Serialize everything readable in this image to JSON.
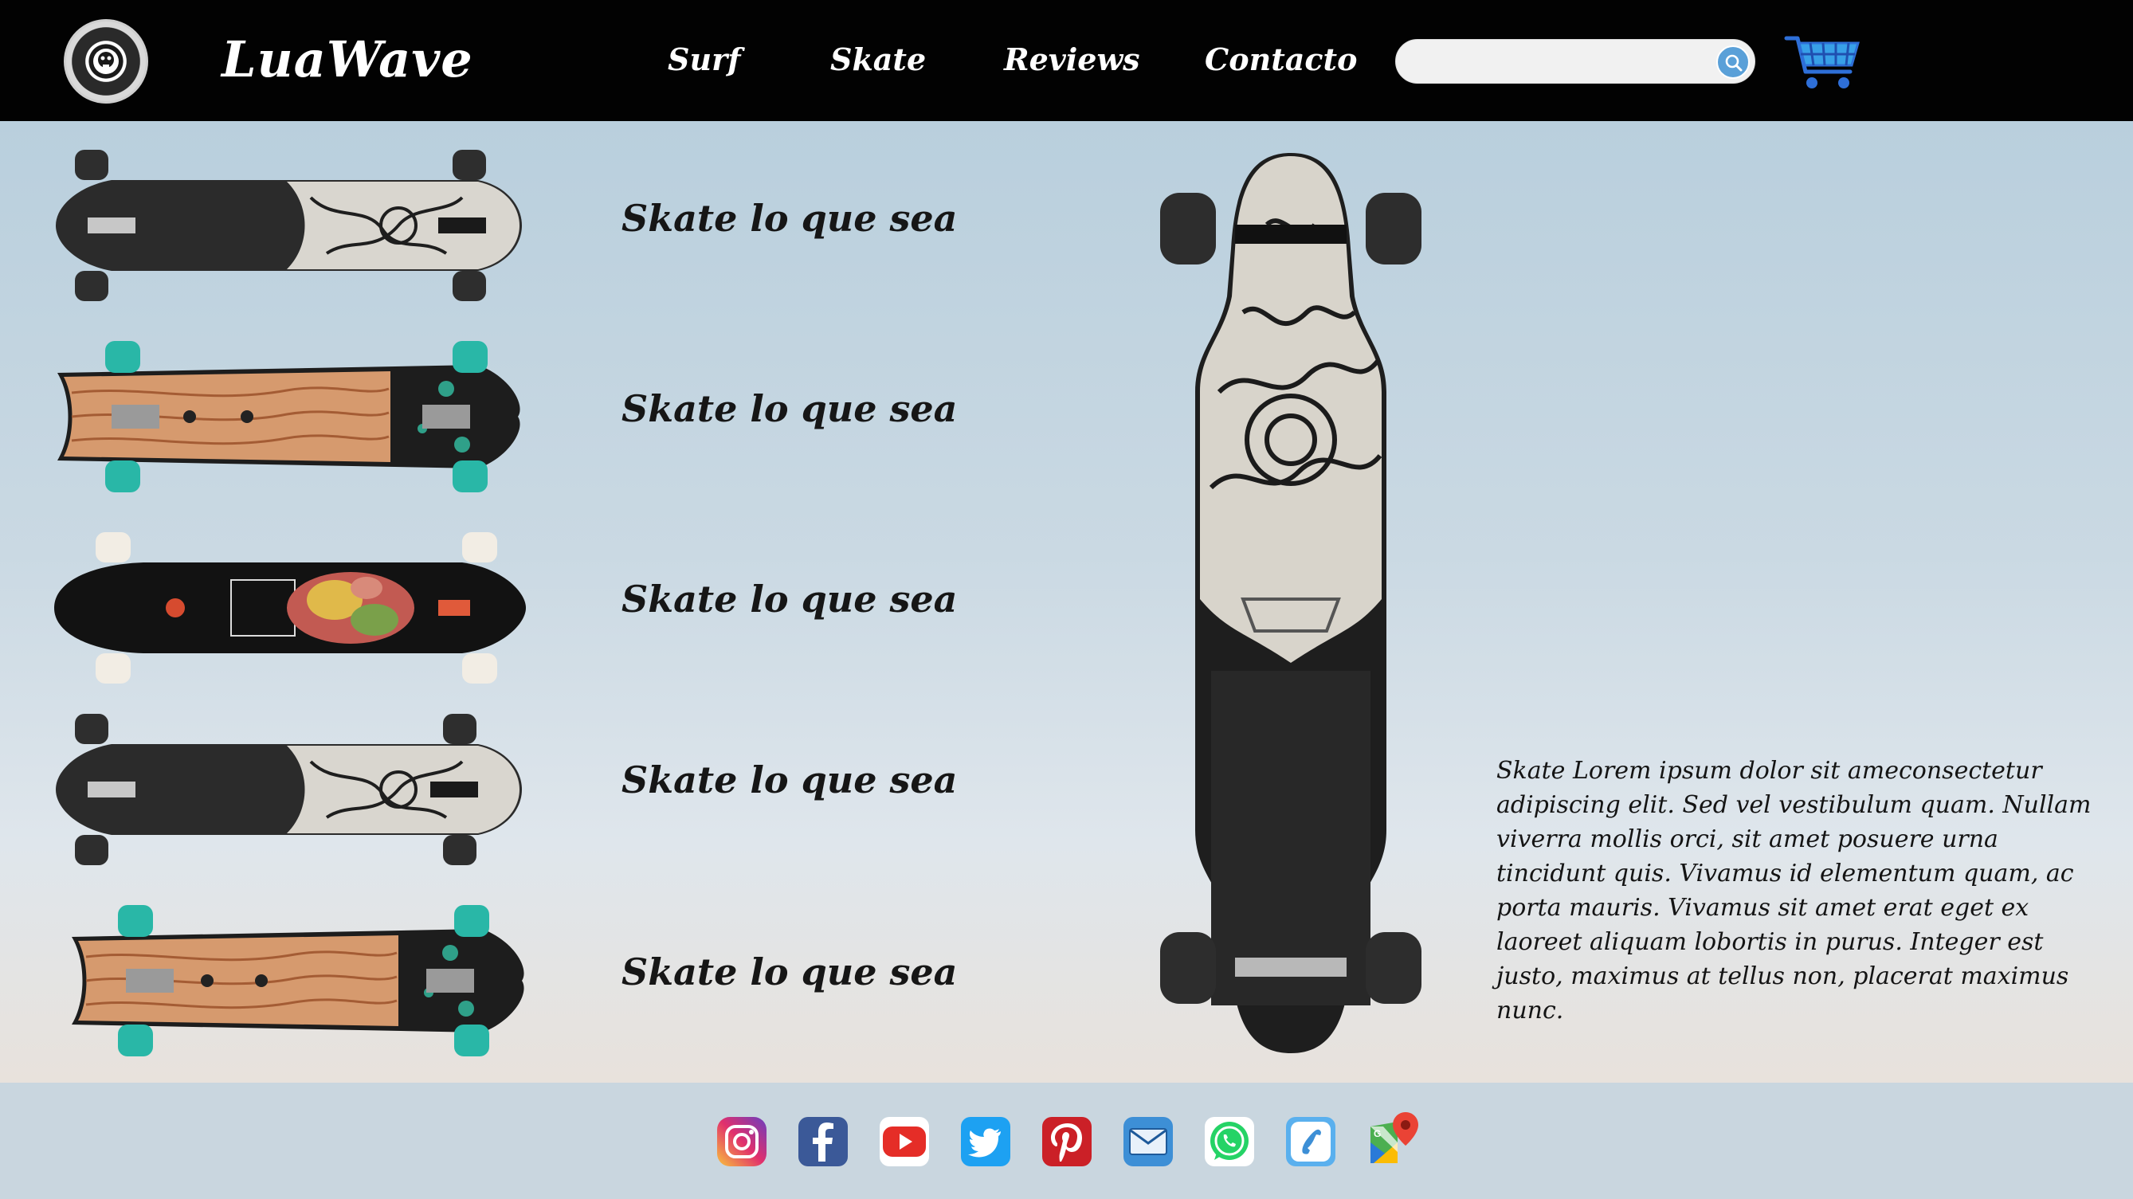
{
  "header": {
    "brand": "LuaWave",
    "logo_icon": "skull-wheel-logo-icon",
    "nav": [
      {
        "label": "Surf"
      },
      {
        "label": "Skate"
      },
      {
        "label": "Reviews"
      },
      {
        "label": "Contacto"
      }
    ],
    "search": {
      "value": "",
      "placeholder": "",
      "icon": "search-icon"
    },
    "cart_icon": "shopping-cart-icon"
  },
  "products": [
    {
      "label": "Skate lo que sea",
      "board": "black-floral-drop-through"
    },
    {
      "label": "Skate lo que sea",
      "board": "wood-grain-fishtail-teal-wheels"
    },
    {
      "label": "Skate lo que sea",
      "board": "black-botanical-pintail"
    },
    {
      "label": "Skate lo que sea",
      "board": "black-floral-drop-through"
    },
    {
      "label": "Skate lo que sea",
      "board": "wood-grain-fishtail-teal-wheels"
    }
  ],
  "featured": {
    "board": "black-floral-longboard",
    "description": "Skate Lorem ipsum dolor sit ameconsectetur adipiscing elit. Sed vel vestibulum quam. Nullam viverra mollis orci, sit amet posuere urna tincidunt quis. Vivamus id elementum quam, ac porta mauris. Vivamus sit amet erat eget ex laoreet aliquam lobortis in purus. Integer est justo, maximus at tellus non, placerat maximus nunc."
  },
  "footer": {
    "social": [
      {
        "name": "instagram-icon"
      },
      {
        "name": "facebook-icon"
      },
      {
        "name": "youtube-icon"
      },
      {
        "name": "twitter-icon"
      },
      {
        "name": "pinterest-icon"
      },
      {
        "name": "mail-icon"
      },
      {
        "name": "whatsapp-icon"
      },
      {
        "name": "phone-icon"
      },
      {
        "name": "google-maps-icon"
      }
    ]
  },
  "colors": {
    "header_bg": "#020202",
    "footer_bg": "#c9d6df",
    "accent_teal": "#2bb3a6",
    "search_button": "#5aa0d8"
  }
}
